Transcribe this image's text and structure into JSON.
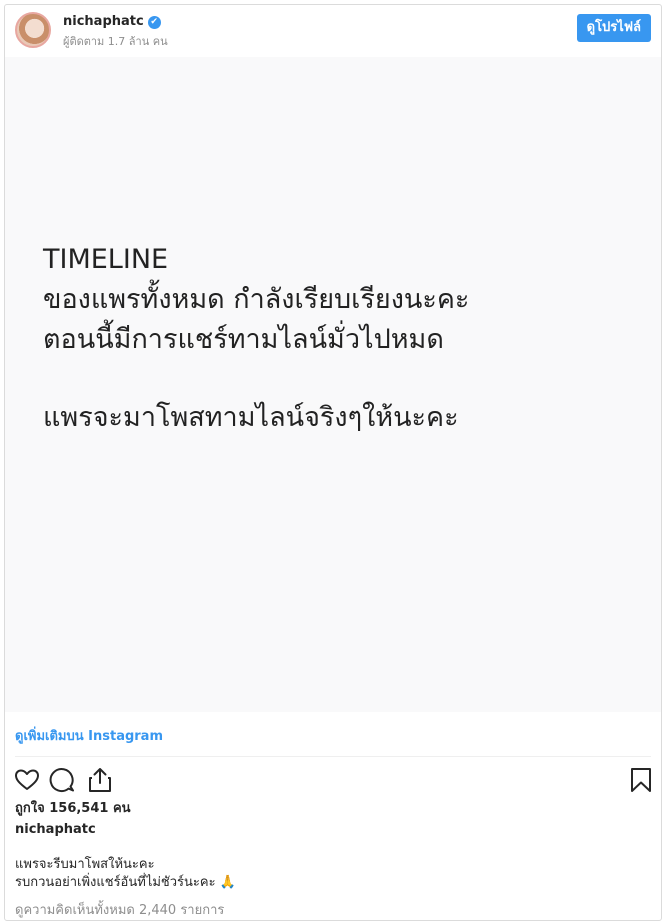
{
  "header": {
    "username": "nichaphatc",
    "verified_mark": "✔",
    "followers": "ผู้ติดตาม 1.7 ล้าน คน",
    "profile_button": "ดูโปรไฟล์"
  },
  "post": {
    "line1": "TIMELINE",
    "line2": "ของแพรทั้งหมด กำลังเรียบเรียงนะคะ",
    "line3": "ตอนนี้มีการแชร์ทามไลน์มั่วไปหมด",
    "line4": "แพรจะมาโพสทามไลน์จริงๆให้นะคะ"
  },
  "more_link": "ดูเพิ่มเติมบน Instagram",
  "icons": {
    "like": "heart-icon",
    "comment": "comment-icon",
    "share": "share-icon",
    "save": "bookmark-icon"
  },
  "likes": "ถูกใจ 156,541 คน",
  "caption": {
    "owner": "nichaphatc",
    "line1": "แพรจะรีบมาโพสให้นะคะ",
    "line2": "รบกวนอย่าเพิ่งแชร์อันที่ไม่ชัวร์นะคะ 🙏"
  },
  "comments_link": "ดูความคิดเห็นทั้งหมด 2,440 รายการ"
}
